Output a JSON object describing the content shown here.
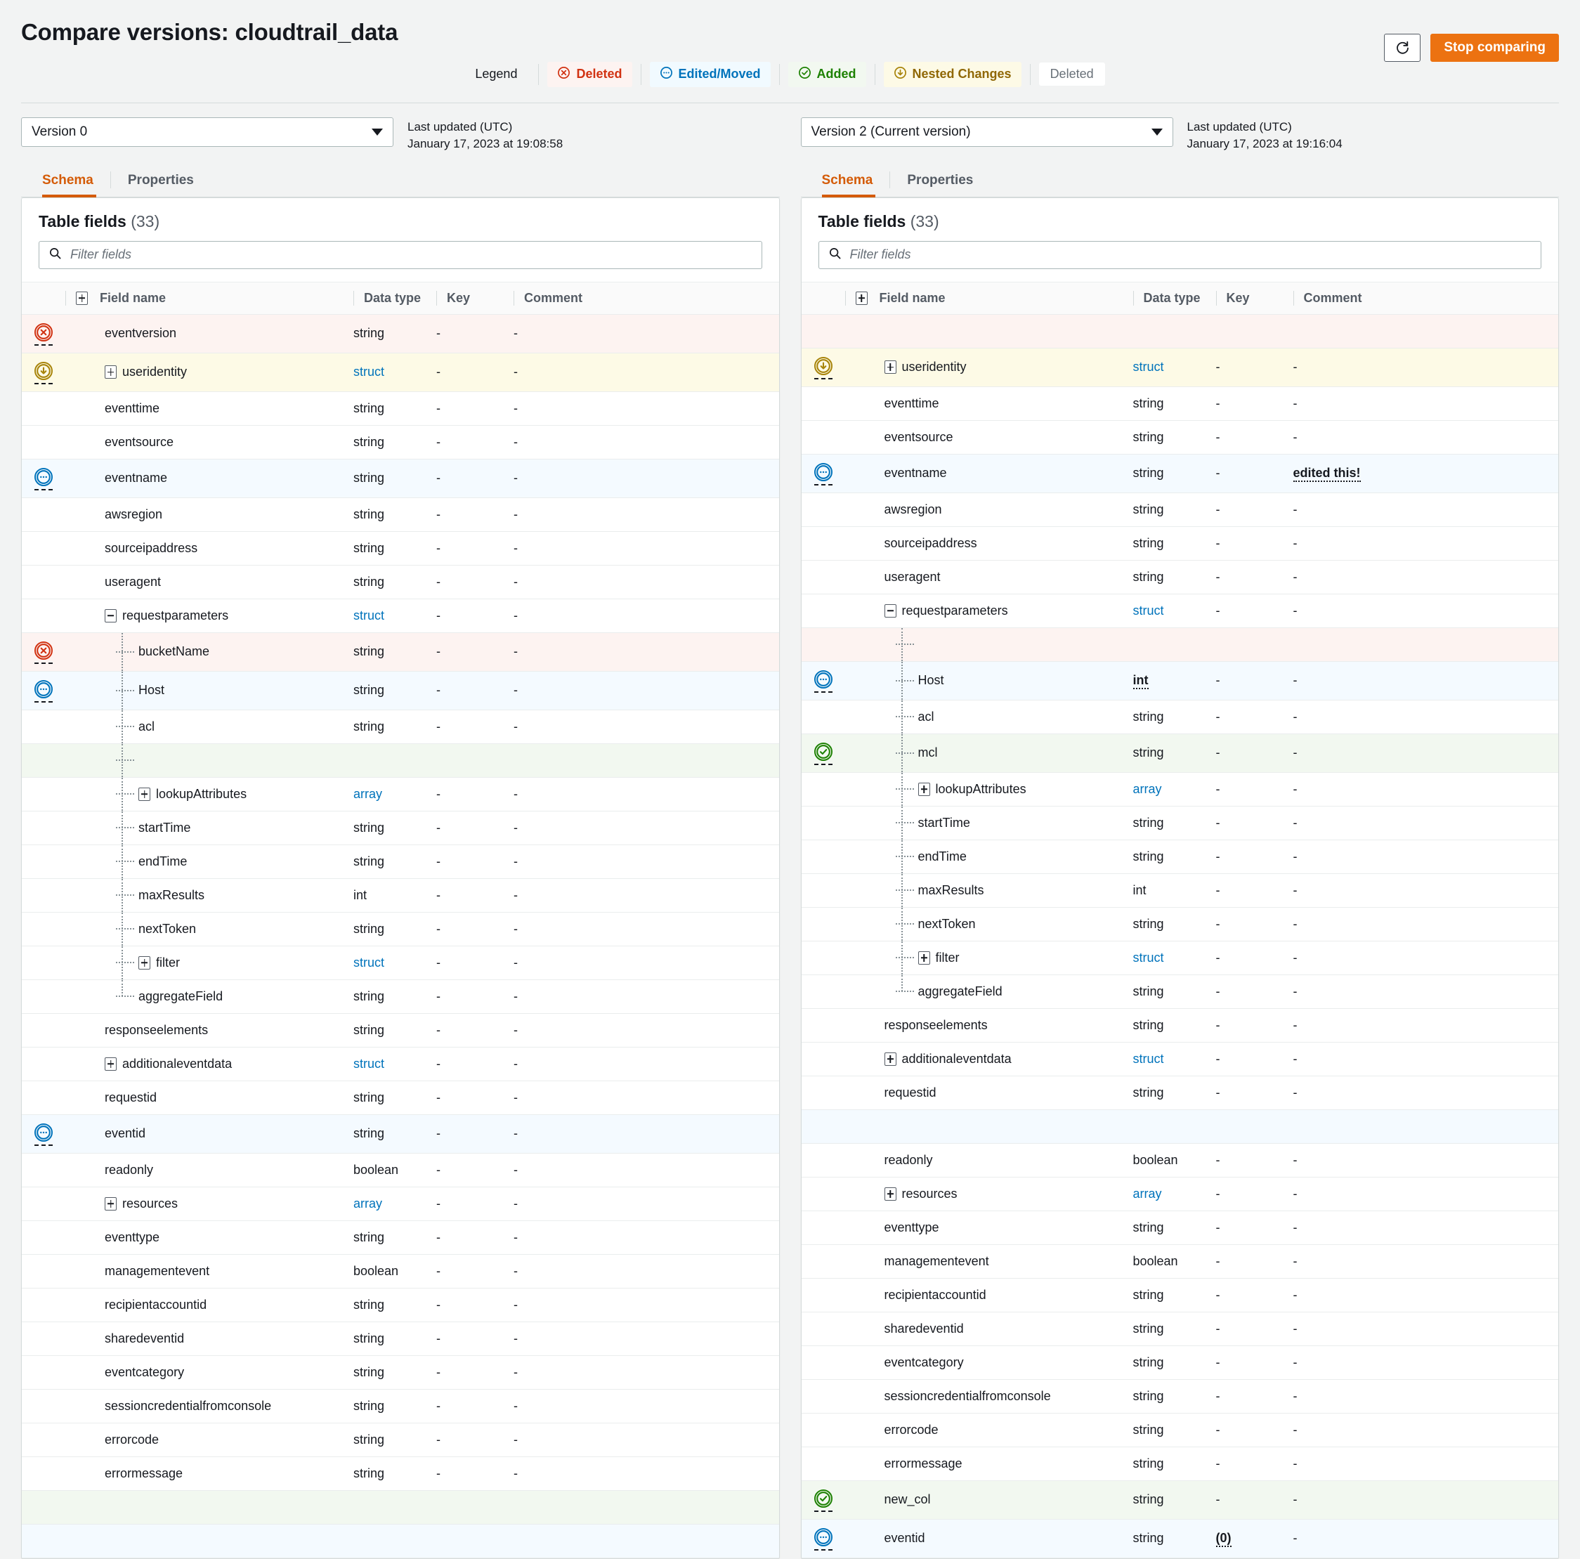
{
  "header": {
    "title": "Compare versions: cloudtrail_data",
    "refresh_icon": "refresh-icon",
    "stop_button": "Stop comparing"
  },
  "legend": {
    "label": "Legend",
    "items": [
      {
        "label": "Deleted",
        "icon": "circle-x-icon",
        "kind": "deleted"
      },
      {
        "label": "Edited/Moved",
        "icon": "circle-dots-icon",
        "kind": "edited"
      },
      {
        "label": "Added",
        "icon": "circle-check-icon",
        "kind": "added"
      },
      {
        "label": "Nested Changes",
        "icon": "circle-arrow-down-icon",
        "kind": "nested"
      },
      {
        "label": "Deleted",
        "icon": "none",
        "kind": "plain"
      }
    ]
  },
  "left": {
    "version_select": "Version 0",
    "last_updated_label": "Last updated (UTC)",
    "last_updated_value": "January 17, 2023 at 19:08:58",
    "tabs": [
      {
        "label": "Schema",
        "active": true
      },
      {
        "label": "Properties",
        "active": false
      }
    ],
    "card_title": "Table fields",
    "card_count": "(33)",
    "filter_placeholder": "Filter fields",
    "columns": [
      "Field name",
      "Data type",
      "Key",
      "Comment"
    ],
    "rows": [
      {
        "status": "deleted",
        "indent": 0,
        "expander": "",
        "name": "eventversion",
        "type": "string",
        "typeLink": false,
        "key": "-",
        "comment": "-"
      },
      {
        "status": "nested",
        "indent": 0,
        "expander": "plus",
        "name": "useridentity",
        "type": "struct",
        "typeLink": true,
        "key": "-",
        "comment": "-"
      },
      {
        "status": "",
        "indent": 0,
        "expander": "",
        "name": "eventtime",
        "type": "string",
        "typeLink": false,
        "key": "-",
        "comment": "-"
      },
      {
        "status": "",
        "indent": 0,
        "expander": "",
        "name": "eventsource",
        "type": "string",
        "typeLink": false,
        "key": "-",
        "comment": "-"
      },
      {
        "status": "edited",
        "indent": 0,
        "expander": "",
        "name": "eventname",
        "type": "string",
        "typeLink": false,
        "key": "-",
        "comment": "-"
      },
      {
        "status": "",
        "indent": 0,
        "expander": "",
        "name": "awsregion",
        "type": "string",
        "typeLink": false,
        "key": "-",
        "comment": "-"
      },
      {
        "status": "",
        "indent": 0,
        "expander": "",
        "name": "sourceipaddress",
        "type": "string",
        "typeLink": false,
        "key": "-",
        "comment": "-"
      },
      {
        "status": "",
        "indent": 0,
        "expander": "",
        "name": "useragent",
        "type": "string",
        "typeLink": false,
        "key": "-",
        "comment": "-"
      },
      {
        "status": "",
        "indent": 0,
        "expander": "minus",
        "name": "requestparameters",
        "type": "struct",
        "typeLink": true,
        "key": "-",
        "comment": "-"
      },
      {
        "status": "deleted",
        "indent": 1,
        "expander": "",
        "name": "bucketName",
        "type": "string",
        "typeLink": false,
        "key": "-",
        "comment": "-"
      },
      {
        "status": "edited",
        "indent": 1,
        "expander": "",
        "name": "Host",
        "type": "string",
        "typeLink": false,
        "key": "-",
        "comment": "-"
      },
      {
        "status": "",
        "indent": 1,
        "expander": "",
        "name": "acl",
        "type": "string",
        "typeLink": false,
        "key": "-",
        "comment": "-"
      },
      {
        "status": "",
        "indent": 1,
        "expander": "",
        "name": "",
        "type": "",
        "typeLink": false,
        "key": "",
        "comment": "",
        "gap": "added"
      },
      {
        "status": "",
        "indent": 1,
        "expander": "plus",
        "name": "lookupAttributes",
        "type": "array",
        "typeLink": true,
        "key": "-",
        "comment": "-"
      },
      {
        "status": "",
        "indent": 1,
        "expander": "",
        "name": "startTime",
        "type": "string",
        "typeLink": false,
        "key": "-",
        "comment": "-"
      },
      {
        "status": "",
        "indent": 1,
        "expander": "",
        "name": "endTime",
        "type": "string",
        "typeLink": false,
        "key": "-",
        "comment": "-"
      },
      {
        "status": "",
        "indent": 1,
        "expander": "",
        "name": "maxResults",
        "type": "int",
        "typeLink": false,
        "key": "-",
        "comment": "-"
      },
      {
        "status": "",
        "indent": 1,
        "expander": "",
        "name": "nextToken",
        "type": "string",
        "typeLink": false,
        "key": "-",
        "comment": "-"
      },
      {
        "status": "",
        "indent": 1,
        "expander": "plus",
        "name": "filter",
        "type": "struct",
        "typeLink": true,
        "key": "-",
        "comment": "-"
      },
      {
        "status": "",
        "indent": 1,
        "expander": "",
        "name": "aggregateField",
        "type": "string",
        "typeLink": false,
        "key": "-",
        "comment": "-"
      },
      {
        "status": "",
        "indent": 0,
        "expander": "",
        "name": "responseelements",
        "type": "string",
        "typeLink": false,
        "key": "-",
        "comment": "-"
      },
      {
        "status": "",
        "indent": 0,
        "expander": "plus",
        "name": "additionaleventdata",
        "type": "struct",
        "typeLink": true,
        "key": "-",
        "comment": "-"
      },
      {
        "status": "",
        "indent": 0,
        "expander": "",
        "name": "requestid",
        "type": "string",
        "typeLink": false,
        "key": "-",
        "comment": "-"
      },
      {
        "status": "edited",
        "indent": 0,
        "expander": "",
        "name": "eventid",
        "type": "string",
        "typeLink": false,
        "key": "-",
        "comment": "-"
      },
      {
        "status": "",
        "indent": 0,
        "expander": "",
        "name": "readonly",
        "type": "boolean",
        "typeLink": false,
        "key": "-",
        "comment": "-"
      },
      {
        "status": "",
        "indent": 0,
        "expander": "plus",
        "name": "resources",
        "type": "array",
        "typeLink": true,
        "key": "-",
        "comment": "-"
      },
      {
        "status": "",
        "indent": 0,
        "expander": "",
        "name": "eventtype",
        "type": "string",
        "typeLink": false,
        "key": "-",
        "comment": "-"
      },
      {
        "status": "",
        "indent": 0,
        "expander": "",
        "name": "managementevent",
        "type": "boolean",
        "typeLink": false,
        "key": "-",
        "comment": "-"
      },
      {
        "status": "",
        "indent": 0,
        "expander": "",
        "name": "recipientaccountid",
        "type": "string",
        "typeLink": false,
        "key": "-",
        "comment": "-"
      },
      {
        "status": "",
        "indent": 0,
        "expander": "",
        "name": "sharedeventid",
        "type": "string",
        "typeLink": false,
        "key": "-",
        "comment": "-"
      },
      {
        "status": "",
        "indent": 0,
        "expander": "",
        "name": "eventcategory",
        "type": "string",
        "typeLink": false,
        "key": "-",
        "comment": "-"
      },
      {
        "status": "",
        "indent": 0,
        "expander": "",
        "name": "sessioncredentialfromconsole",
        "type": "string",
        "typeLink": false,
        "key": "-",
        "comment": "-"
      },
      {
        "status": "",
        "indent": 0,
        "expander": "",
        "name": "errorcode",
        "type": "string",
        "typeLink": false,
        "key": "-",
        "comment": "-"
      },
      {
        "status": "",
        "indent": 0,
        "expander": "",
        "name": "errormessage",
        "type": "string",
        "typeLink": false,
        "key": "-",
        "comment": "-"
      },
      {
        "status": "",
        "indent": 0,
        "expander": "",
        "name": "",
        "type": "",
        "typeLink": false,
        "key": "",
        "comment": "",
        "gap": "added"
      },
      {
        "status": "",
        "indent": 0,
        "expander": "",
        "name": "",
        "type": "",
        "typeLink": false,
        "key": "",
        "comment": "",
        "gap": "edited"
      }
    ]
  },
  "right": {
    "version_select": "Version 2 (Current version)",
    "last_updated_label": "Last updated (UTC)",
    "last_updated_value": "January 17, 2023 at 19:16:04",
    "tabs": [
      {
        "label": "Schema",
        "active": true
      },
      {
        "label": "Properties",
        "active": false
      }
    ],
    "card_title": "Table fields",
    "card_count": "(33)",
    "filter_placeholder": "Filter fields",
    "columns": [
      "Field name",
      "Data type",
      "Key",
      "Comment"
    ],
    "rows": [
      {
        "status": "",
        "indent": 0,
        "expander": "",
        "name": "",
        "type": "",
        "typeLink": false,
        "key": "",
        "comment": "",
        "gap": "deleted"
      },
      {
        "status": "nested",
        "indent": 0,
        "expander": "plus",
        "name": "useridentity",
        "type": "struct",
        "typeLink": true,
        "key": "-",
        "comment": "-"
      },
      {
        "status": "",
        "indent": 0,
        "expander": "",
        "name": "eventtime",
        "type": "string",
        "typeLink": false,
        "key": "-",
        "comment": "-"
      },
      {
        "status": "",
        "indent": 0,
        "expander": "",
        "name": "eventsource",
        "type": "string",
        "typeLink": false,
        "key": "-",
        "comment": "-"
      },
      {
        "status": "edited",
        "indent": 0,
        "expander": "",
        "name": "eventname",
        "type": "string",
        "typeLink": false,
        "key": "-",
        "comment": "edited this!",
        "commentEmph": true
      },
      {
        "status": "",
        "indent": 0,
        "expander": "",
        "name": "awsregion",
        "type": "string",
        "typeLink": false,
        "key": "-",
        "comment": "-"
      },
      {
        "status": "",
        "indent": 0,
        "expander": "",
        "name": "sourceipaddress",
        "type": "string",
        "typeLink": false,
        "key": "-",
        "comment": "-"
      },
      {
        "status": "",
        "indent": 0,
        "expander": "",
        "name": "useragent",
        "type": "string",
        "typeLink": false,
        "key": "-",
        "comment": "-"
      },
      {
        "status": "",
        "indent": 0,
        "expander": "minus",
        "name": "requestparameters",
        "type": "struct",
        "typeLink": true,
        "key": "-",
        "comment": "-"
      },
      {
        "status": "",
        "indent": 1,
        "expander": "",
        "name": "",
        "type": "",
        "typeLink": false,
        "key": "",
        "comment": "",
        "gap": "deleted"
      },
      {
        "status": "edited",
        "indent": 1,
        "expander": "",
        "name": "Host",
        "type": "int",
        "typeLink": false,
        "typeEmph": true,
        "key": "-",
        "comment": "-"
      },
      {
        "status": "",
        "indent": 1,
        "expander": "",
        "name": "acl",
        "type": "string",
        "typeLink": false,
        "key": "-",
        "comment": "-"
      },
      {
        "status": "added",
        "indent": 1,
        "expander": "",
        "name": "mcl",
        "type": "string",
        "typeLink": false,
        "key": "-",
        "comment": "-"
      },
      {
        "status": "",
        "indent": 1,
        "expander": "plus",
        "name": "lookupAttributes",
        "type": "array",
        "typeLink": true,
        "key": "-",
        "comment": "-"
      },
      {
        "status": "",
        "indent": 1,
        "expander": "",
        "name": "startTime",
        "type": "string",
        "typeLink": false,
        "key": "-",
        "comment": "-"
      },
      {
        "status": "",
        "indent": 1,
        "expander": "",
        "name": "endTime",
        "type": "string",
        "typeLink": false,
        "key": "-",
        "comment": "-"
      },
      {
        "status": "",
        "indent": 1,
        "expander": "",
        "name": "maxResults",
        "type": "int",
        "typeLink": false,
        "key": "-",
        "comment": "-"
      },
      {
        "status": "",
        "indent": 1,
        "expander": "",
        "name": "nextToken",
        "type": "string",
        "typeLink": false,
        "key": "-",
        "comment": "-"
      },
      {
        "status": "",
        "indent": 1,
        "expander": "plus",
        "name": "filter",
        "type": "struct",
        "typeLink": true,
        "key": "-",
        "comment": "-"
      },
      {
        "status": "",
        "indent": 1,
        "expander": "",
        "name": "aggregateField",
        "type": "string",
        "typeLink": false,
        "key": "-",
        "comment": "-"
      },
      {
        "status": "",
        "indent": 0,
        "expander": "",
        "name": "responseelements",
        "type": "string",
        "typeLink": false,
        "key": "-",
        "comment": "-"
      },
      {
        "status": "",
        "indent": 0,
        "expander": "plus",
        "name": "additionaleventdata",
        "type": "struct",
        "typeLink": true,
        "key": "-",
        "comment": "-"
      },
      {
        "status": "",
        "indent": 0,
        "expander": "",
        "name": "requestid",
        "type": "string",
        "typeLink": false,
        "key": "-",
        "comment": "-"
      },
      {
        "status": "",
        "indent": 0,
        "expander": "",
        "name": "",
        "type": "",
        "typeLink": false,
        "key": "",
        "comment": "",
        "gap": "edited"
      },
      {
        "status": "",
        "indent": 0,
        "expander": "",
        "name": "readonly",
        "type": "boolean",
        "typeLink": false,
        "key": "-",
        "comment": "-"
      },
      {
        "status": "",
        "indent": 0,
        "expander": "plus",
        "name": "resources",
        "type": "array",
        "typeLink": true,
        "key": "-",
        "comment": "-"
      },
      {
        "status": "",
        "indent": 0,
        "expander": "",
        "name": "eventtype",
        "type": "string",
        "typeLink": false,
        "key": "-",
        "comment": "-"
      },
      {
        "status": "",
        "indent": 0,
        "expander": "",
        "name": "managementevent",
        "type": "boolean",
        "typeLink": false,
        "key": "-",
        "comment": "-"
      },
      {
        "status": "",
        "indent": 0,
        "expander": "",
        "name": "recipientaccountid",
        "type": "string",
        "typeLink": false,
        "key": "-",
        "comment": "-"
      },
      {
        "status": "",
        "indent": 0,
        "expander": "",
        "name": "sharedeventid",
        "type": "string",
        "typeLink": false,
        "key": "-",
        "comment": "-"
      },
      {
        "status": "",
        "indent": 0,
        "expander": "",
        "name": "eventcategory",
        "type": "string",
        "typeLink": false,
        "key": "-",
        "comment": "-"
      },
      {
        "status": "",
        "indent": 0,
        "expander": "",
        "name": "sessioncredentialfromconsole",
        "type": "string",
        "typeLink": false,
        "key": "-",
        "comment": "-"
      },
      {
        "status": "",
        "indent": 0,
        "expander": "",
        "name": "errorcode",
        "type": "string",
        "typeLink": false,
        "key": "-",
        "comment": "-"
      },
      {
        "status": "",
        "indent": 0,
        "expander": "",
        "name": "errormessage",
        "type": "string",
        "typeLink": false,
        "key": "-",
        "comment": "-"
      },
      {
        "status": "added",
        "indent": 0,
        "expander": "",
        "name": "new_col",
        "type": "string",
        "typeLink": false,
        "key": "-",
        "comment": "-"
      },
      {
        "status": "edited",
        "indent": 0,
        "expander": "",
        "name": "eventid",
        "type": "string",
        "typeLink": false,
        "key": "(0)",
        "keyEmph": true,
        "comment": "-"
      }
    ]
  },
  "colors": {
    "accent": "#ec7211",
    "deleted": "#d13212",
    "edited": "#0073bb",
    "added": "#1d8102",
    "nested": "#906806",
    "link": "#0073bb"
  }
}
